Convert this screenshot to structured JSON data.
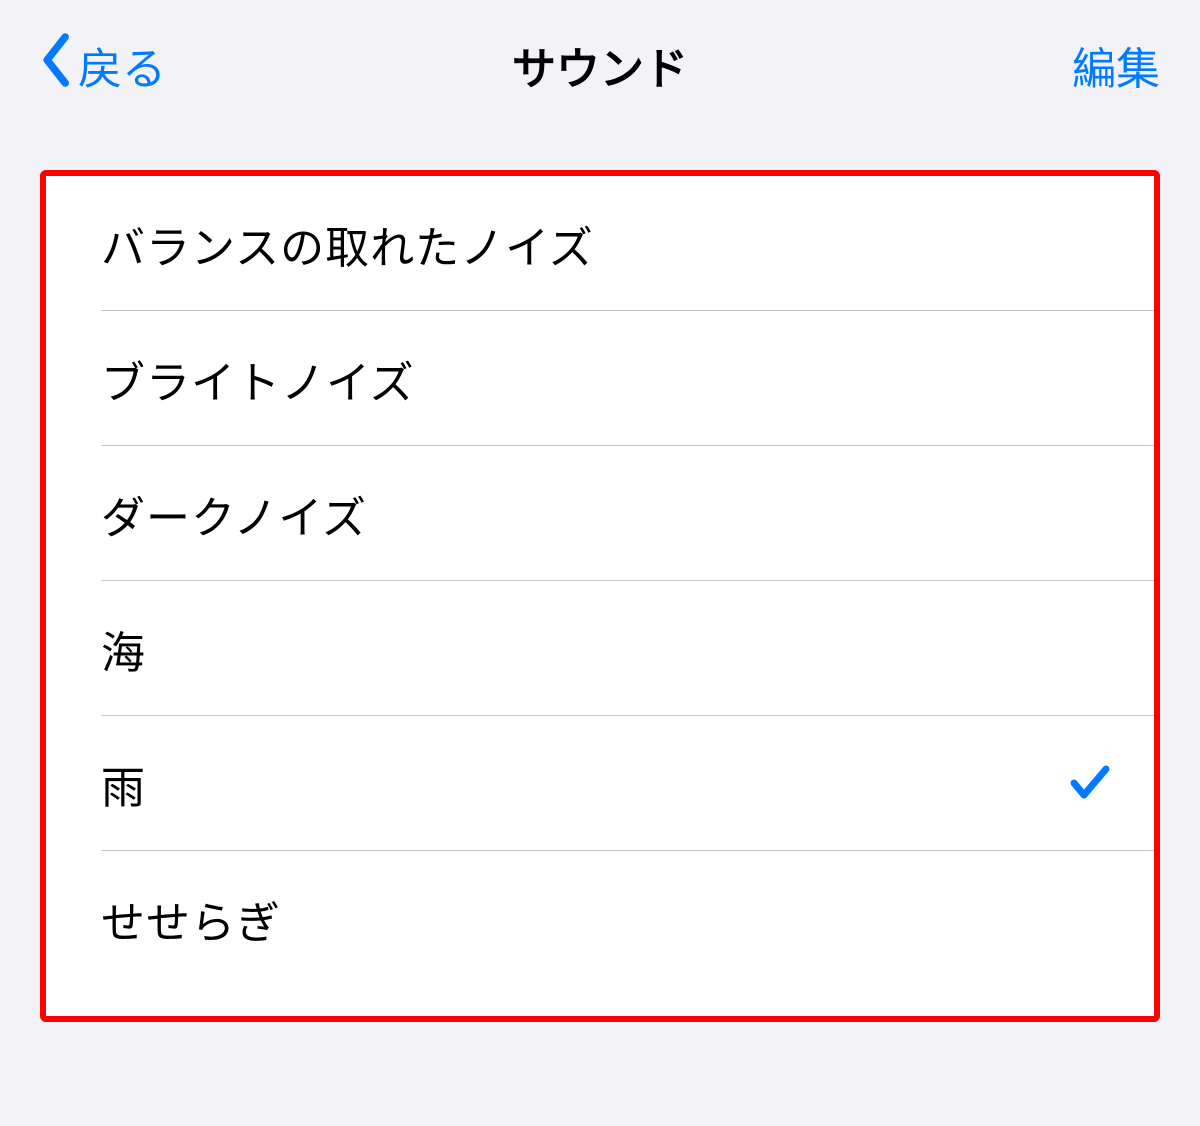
{
  "nav": {
    "back_label": "戻る",
    "title": "サウンド",
    "edit_label": "編集"
  },
  "list": {
    "items": [
      {
        "label": "バランスの取れたノイズ",
        "selected": false
      },
      {
        "label": "ブライトノイズ",
        "selected": false
      },
      {
        "label": "ダークノイズ",
        "selected": false
      },
      {
        "label": "海",
        "selected": false
      },
      {
        "label": "雨",
        "selected": true
      },
      {
        "label": "せせらぎ",
        "selected": false
      }
    ]
  },
  "colors": {
    "accent": "#007aff",
    "highlight_border": "#ff0000",
    "background": "#f2f2f7"
  }
}
